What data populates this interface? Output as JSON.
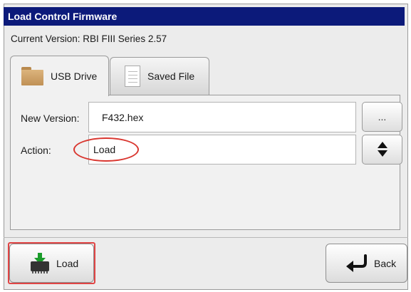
{
  "window": {
    "title": "Load Control Firmware"
  },
  "current_version": "Current Version: RBI FIII Series 2.57",
  "tabs": [
    {
      "label": "USB Drive",
      "icon": "folder-icon",
      "active": true
    },
    {
      "label": "Saved File",
      "icon": "document-icon",
      "active": false
    }
  ],
  "form": {
    "new_version_label": "New Version:",
    "new_version_value": "F432.hex",
    "browse_label": "...",
    "action_label": "Action:",
    "action_value": "Load"
  },
  "buttons": {
    "load_label": "Load",
    "back_label": "Back"
  },
  "colors": {
    "titlebar": "#0c1a7a",
    "highlight": "#d9362f",
    "download_arrow": "#1a9b2a"
  }
}
